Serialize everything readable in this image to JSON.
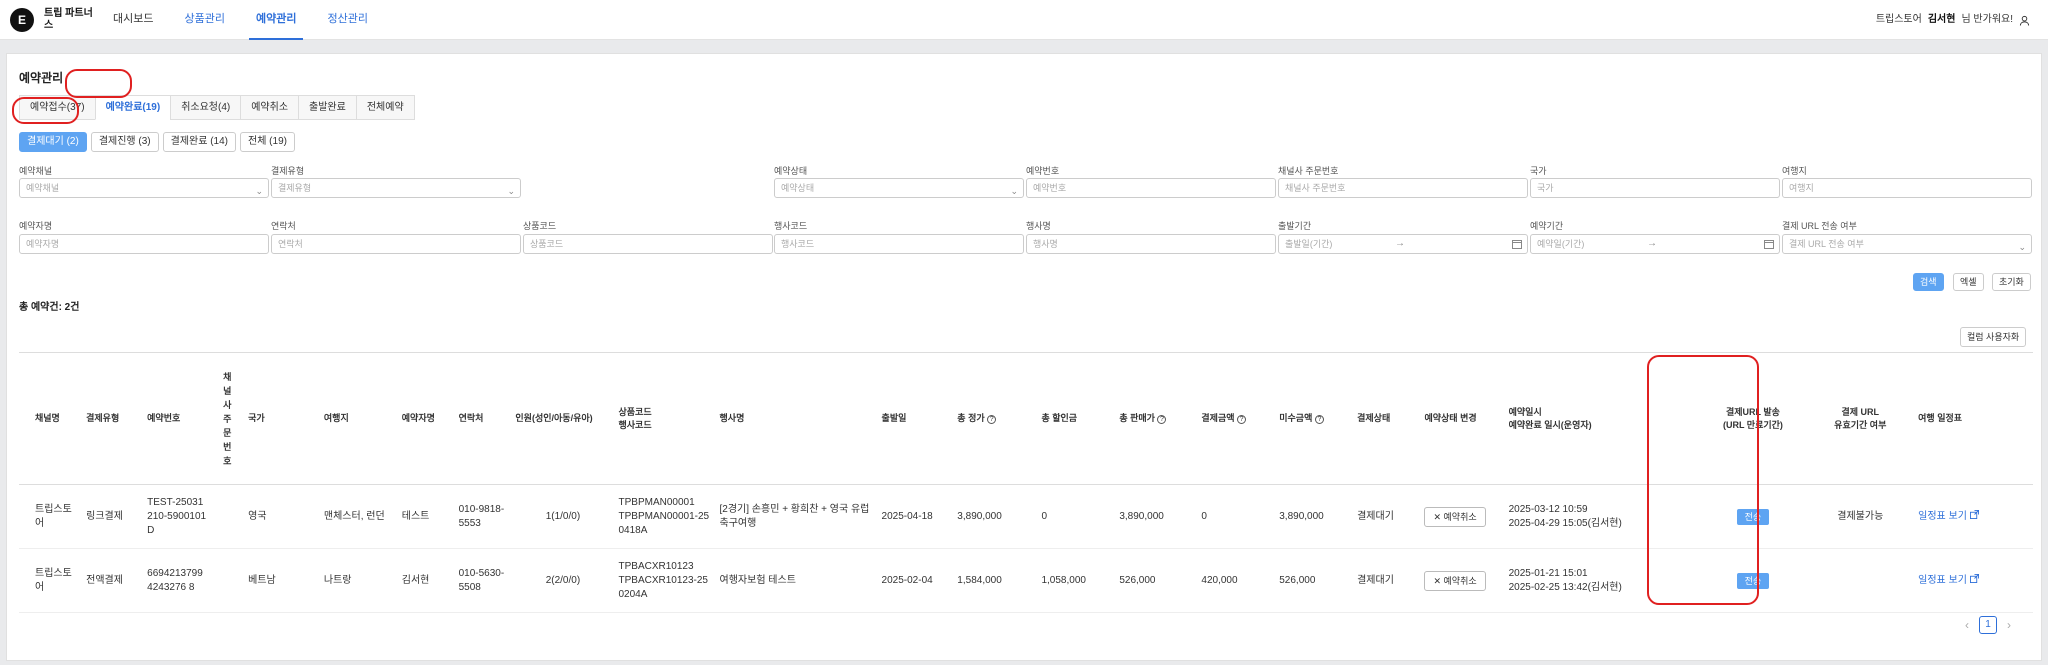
{
  "header": {
    "logo_letter": "E",
    "logo_text": "트립 파트너스",
    "nav": [
      {
        "label": "대시보드"
      },
      {
        "label": "상품관리"
      },
      {
        "label": "예약관리"
      },
      {
        "label": "정산관리"
      }
    ],
    "store": "트립스토어",
    "user_name": "김서현",
    "greeting": "님 반가워요!"
  },
  "page": {
    "title": "예약관리",
    "tabs": [
      {
        "label": "예약접수(37)"
      },
      {
        "label": "예약완료(19)"
      },
      {
        "label": "취소요청(4)"
      },
      {
        "label": "예약취소"
      },
      {
        "label": "출발완료"
      },
      {
        "label": "전체예약"
      }
    ],
    "subtabs": [
      {
        "label": "결제대기 (2)"
      },
      {
        "label": "결제진행 (3)"
      },
      {
        "label": "결제완료 (14)"
      },
      {
        "label": "전체 (19)"
      }
    ]
  },
  "filters": {
    "row1": [
      {
        "label": "예약채널",
        "placeholder": "예약채널"
      },
      {
        "label": "결제유형",
        "placeholder": "결제유형"
      },
      {
        "label": "예약상태",
        "placeholder": "예약상태"
      },
      {
        "label": "예약번호",
        "placeholder": "예약번호"
      },
      {
        "label": "채널사 주문번호",
        "placeholder": "채널사 주문번호"
      },
      {
        "label": "국가",
        "placeholder": "국가"
      },
      {
        "label": "여행지",
        "placeholder": "여행지"
      }
    ],
    "row2": [
      {
        "label": "예약자명",
        "placeholder": "예약자명"
      },
      {
        "label": "연락처",
        "placeholder": "연락처"
      },
      {
        "label": "상품코드",
        "placeholder": "상품코드"
      },
      {
        "label": "행사코드",
        "placeholder": "행사코드"
      },
      {
        "label": "행사명",
        "placeholder": "행사명"
      },
      {
        "label": "출발기간",
        "placeholder": "출발일(기간)"
      },
      {
        "label": "예약기간",
        "placeholder": "예약일(기간)"
      },
      {
        "label": "결제 URL 전송 여부",
        "placeholder": "결제 URL 전송 여부"
      }
    ]
  },
  "actions": {
    "search": "검색",
    "excel": "엑셀",
    "reset": "초기화",
    "column_custom": "컬럼 사용자화"
  },
  "summary": {
    "total": "총 예약건: 2건"
  },
  "table": {
    "headers": {
      "channel": "채널명",
      "pay_type": "결제유형",
      "res_no": "예약번호",
      "order_no": "채널사주문번호",
      "country": "국가",
      "destination": "여행지",
      "booker": "예약자명",
      "phone": "연락처",
      "pax": "인원(성인/아동/유아)",
      "codes": "상품코드\n행사코드",
      "event": "행사명",
      "depart": "출발일",
      "total_price": "총 정가",
      "total_discount": "총 할인금",
      "total_sale": "총 판매가",
      "paid": "결제금액",
      "unpaid": "미수금액",
      "pay_status": "결제상태",
      "status_change": "예약상태 변경",
      "res_dates": "예약일시\n예약완료 일시(운영자)",
      "url_send": "결제URL 발송\n(URL 만료기간)",
      "url_valid": "결제 URL\n유효기간 여부",
      "itinerary": "여행 일정표"
    },
    "rows": [
      {
        "channel": "트립스토어",
        "pay_type": "링크결제",
        "res_no": "TEST-25031210-5900101D",
        "country": "영국",
        "destination": "맨체스터, 런던",
        "booker": "테스트",
        "phone": "010-9818-5553",
        "pax": "1(1/0/0)",
        "code1": "TPBPMAN00001",
        "code2": "TPBPMAN00001-250418A",
        "event": "[2경기] 손흥민 + 황희찬 + 영국 유럽 축구여행",
        "depart": "2025-04-18",
        "total_price": "3,890,000",
        "total_discount": "0",
        "total_sale": "3,890,000",
        "paid": "0",
        "unpaid": "3,890,000",
        "pay_status": "결제대기",
        "cancel": "예약취소",
        "date1": "2025-03-12 10:59",
        "date2": "2025-04-29 15:05(김서현)",
        "send": "전송",
        "url_valid": "결제불가능",
        "itinerary": "일정표 보기"
      },
      {
        "channel": "트립스토어",
        "pay_type": "전액결제",
        "res_no": "66942137994243276 8",
        "country": "베트남",
        "destination": "나트랑",
        "booker": "김서현",
        "phone": "010-5630-5508",
        "pax": "2(2/0/0)",
        "code1": "TPBACXR10123",
        "code2": "TPBACXR10123-250204A",
        "event": "여행자보험 테스트",
        "depart": "2025-02-04",
        "total_price": "1,584,000",
        "total_discount": "1,058,000",
        "total_sale": "526,000",
        "paid": "420,000",
        "unpaid": "526,000",
        "pay_status": "결제대기",
        "cancel": "예약취소",
        "date1": "2025-01-21 15:01",
        "date2": "2025-02-25 13:42(김서현)",
        "send": "전송",
        "url_valid": "",
        "itinerary": "일정표 보기"
      }
    ]
  },
  "pagination": {
    "current": "1"
  }
}
